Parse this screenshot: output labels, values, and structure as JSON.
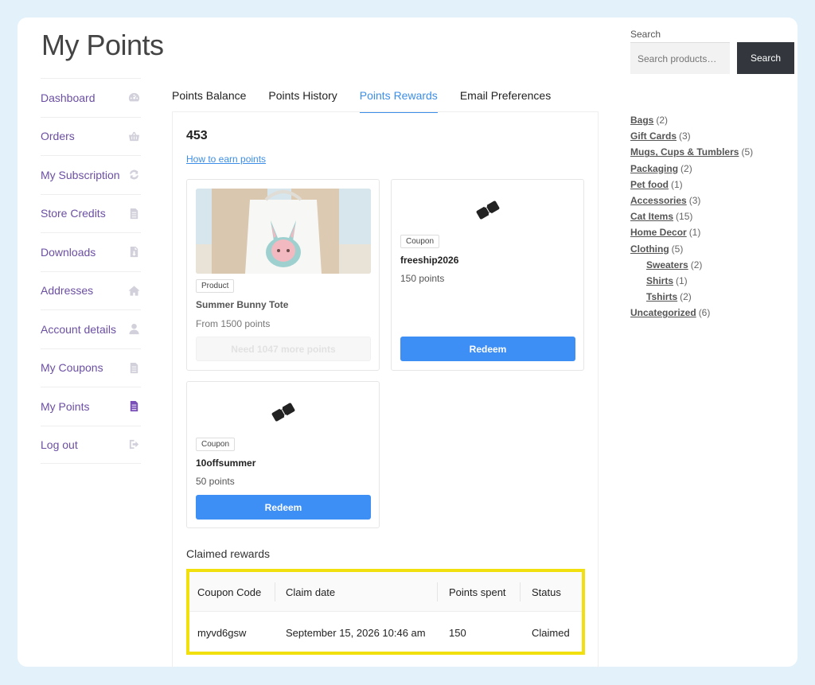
{
  "page": {
    "title": "My Points"
  },
  "nav": {
    "items": [
      {
        "label": "Dashboard",
        "icon": "dashboard-icon"
      },
      {
        "label": "Orders",
        "icon": "basket-icon"
      },
      {
        "label": "My Subscription",
        "icon": "refresh-icon"
      },
      {
        "label": "Store Credits",
        "icon": "document-icon"
      },
      {
        "label": "Downloads",
        "icon": "file-icon"
      },
      {
        "label": "Addresses",
        "icon": "home-icon"
      },
      {
        "label": "Account details",
        "icon": "user-icon"
      },
      {
        "label": "My Coupons",
        "icon": "document-icon"
      },
      {
        "label": "My Points",
        "icon": "document-icon",
        "active": true
      },
      {
        "label": "Log out",
        "icon": "logout-icon"
      }
    ]
  },
  "tabs": [
    {
      "label": "Points Balance"
    },
    {
      "label": "Points History"
    },
    {
      "label": "Points Rewards",
      "active": true
    },
    {
      "label": "Email Preferences"
    }
  ],
  "balance": "453",
  "earn_link": "How to earn points",
  "rewards": [
    {
      "badge": "Product",
      "title": "Summer Bunny Tote",
      "points": "From 1500 points",
      "button": "Need 1047 more points",
      "enabled": false
    },
    {
      "badge": "Coupon",
      "title": "freeship2026",
      "points": "150 points",
      "button": "Redeem",
      "enabled": true
    },
    {
      "badge": "Coupon",
      "title": "10offsummer",
      "points": "50 points",
      "button": "Redeem",
      "enabled": true
    }
  ],
  "claimed": {
    "title": "Claimed rewards",
    "headers": [
      "Coupon Code",
      "Claim date",
      "Points spent",
      "Status"
    ],
    "rows": [
      [
        "myvd6gsw",
        "September 15, 2026 10:46 am",
        "150",
        "Claimed"
      ]
    ]
  },
  "search": {
    "label": "Search",
    "placeholder": "Search products…",
    "button": "Search"
  },
  "categories": [
    {
      "name": "Bags",
      "count": "(2)"
    },
    {
      "name": "Gift Cards",
      "count": "(3)"
    },
    {
      "name": "Mugs, Cups & Tumblers",
      "count": "(5)"
    },
    {
      "name": "Packaging",
      "count": "(2)"
    },
    {
      "name": "Pet food",
      "count": "(1)"
    },
    {
      "name": "Accessories",
      "count": "(3)"
    },
    {
      "name": "Cat Items",
      "count": "(15)"
    },
    {
      "name": "Home Decor",
      "count": "(1)"
    },
    {
      "name": "Clothing",
      "count": "(5)"
    },
    {
      "name": "Sweaters",
      "count": "(2)",
      "sub": true
    },
    {
      "name": "Shirts",
      "count": "(1)",
      "sub": true
    },
    {
      "name": "Tshirts",
      "count": "(2)",
      "sub": true
    },
    {
      "name": "Uncategorized",
      "count": "(6)"
    }
  ],
  "colors": {
    "accent": "#3d8ef5",
    "nav_text": "#6b4fa3",
    "highlight": "#f2df0e",
    "page_bg": "#e3f1fb"
  }
}
